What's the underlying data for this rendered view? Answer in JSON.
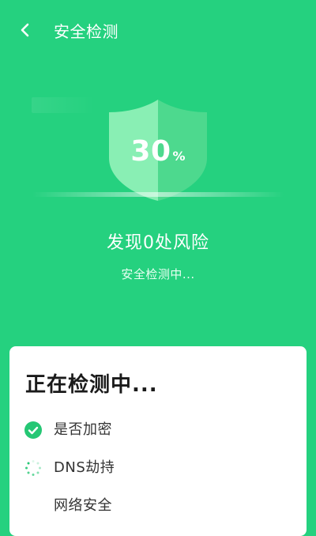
{
  "header": {
    "title": "安全检测",
    "back_icon": "chevron-left-icon"
  },
  "progress": {
    "value": "30",
    "unit": "%"
  },
  "status": {
    "headline": "发现0处风险",
    "subtext": "安全检测中..."
  },
  "card": {
    "title": "正在检测中...",
    "items": [
      {
        "label": "是否加密",
        "state": "done",
        "icon": "check-circle-icon"
      },
      {
        "label": "DNS劫持",
        "state": "in-progress",
        "icon": "spinner-icon"
      },
      {
        "label": "网络安全",
        "state": "pending",
        "icon": ""
      }
    ]
  },
  "colors": {
    "background": "#25d17f",
    "shield_light": "#8ef0b7",
    "shield_dark": "#4fd98f",
    "check": "#25c774"
  }
}
